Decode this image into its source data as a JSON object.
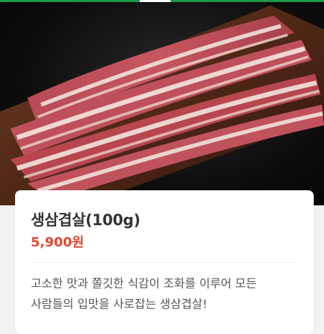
{
  "product": {
    "image_alt": "삼겹살 고기 사진",
    "name": "생삼겹살(100g)",
    "price": "5,900원",
    "description": "고소한 맛과 쫄깃한 식감이 조화를 이루어 모든 사람들의 입맛을 사로잡는 생삼겹살!"
  },
  "colors": {
    "accent_green": "#1e9a47",
    "price_red": "#e8452f"
  }
}
